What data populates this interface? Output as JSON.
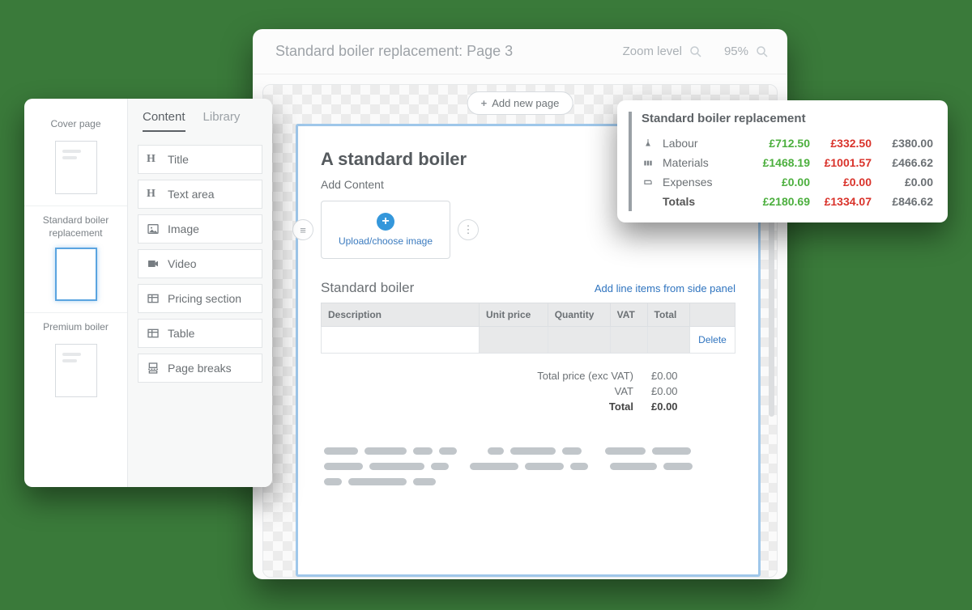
{
  "editor": {
    "title": "Standard boiler replacement: Page 3",
    "zoom_label": "Zoom level",
    "zoom_value": "95%",
    "add_page": "Add new page"
  },
  "page": {
    "heading": "A standard boiler",
    "add_content": "Add Content",
    "upload_text": "Upload/choose image",
    "section_title": "Standard boiler",
    "side_panel_link": "Add line items from side panel",
    "columns": {
      "description": "Description",
      "unit_price": "Unit price",
      "quantity": "Quantity",
      "vat": "VAT",
      "total": "Total"
    },
    "delete_label": "Delete",
    "totals": {
      "exc_vat_label": "Total price (exc VAT)",
      "exc_vat_value": "£0.00",
      "vat_label": "VAT",
      "vat_value": "£0.00",
      "total_label": "Total",
      "total_value": "£0.00"
    }
  },
  "sidebar": {
    "pages": [
      {
        "label": "Cover page"
      },
      {
        "label": "Standard boiler replacement"
      },
      {
        "label": "Premium boiler"
      }
    ],
    "tabs": {
      "content": "Content",
      "library": "Library"
    },
    "items": {
      "title": "Title",
      "text_area": "Text area",
      "image": "Image",
      "video": "Video",
      "pricing": "Pricing section",
      "table": "Table",
      "breaks": "Page breaks"
    }
  },
  "summary": {
    "title": "Standard boiler replacement",
    "rows": {
      "labour": {
        "label": "Labour",
        "c1": "£712.50",
        "c2": "£332.50",
        "c3": "£380.00"
      },
      "materials": {
        "label": "Materials",
        "c1": "£1468.19",
        "c2": "£1001.57",
        "c3": "£466.62"
      },
      "expenses": {
        "label": "Expenses",
        "c1": "£0.00",
        "c2": "£0.00",
        "c3": "£0.00"
      },
      "totals": {
        "label": "Totals",
        "c1": "£2180.69",
        "c2": "£1334.07",
        "c3": "£846.62"
      }
    }
  }
}
